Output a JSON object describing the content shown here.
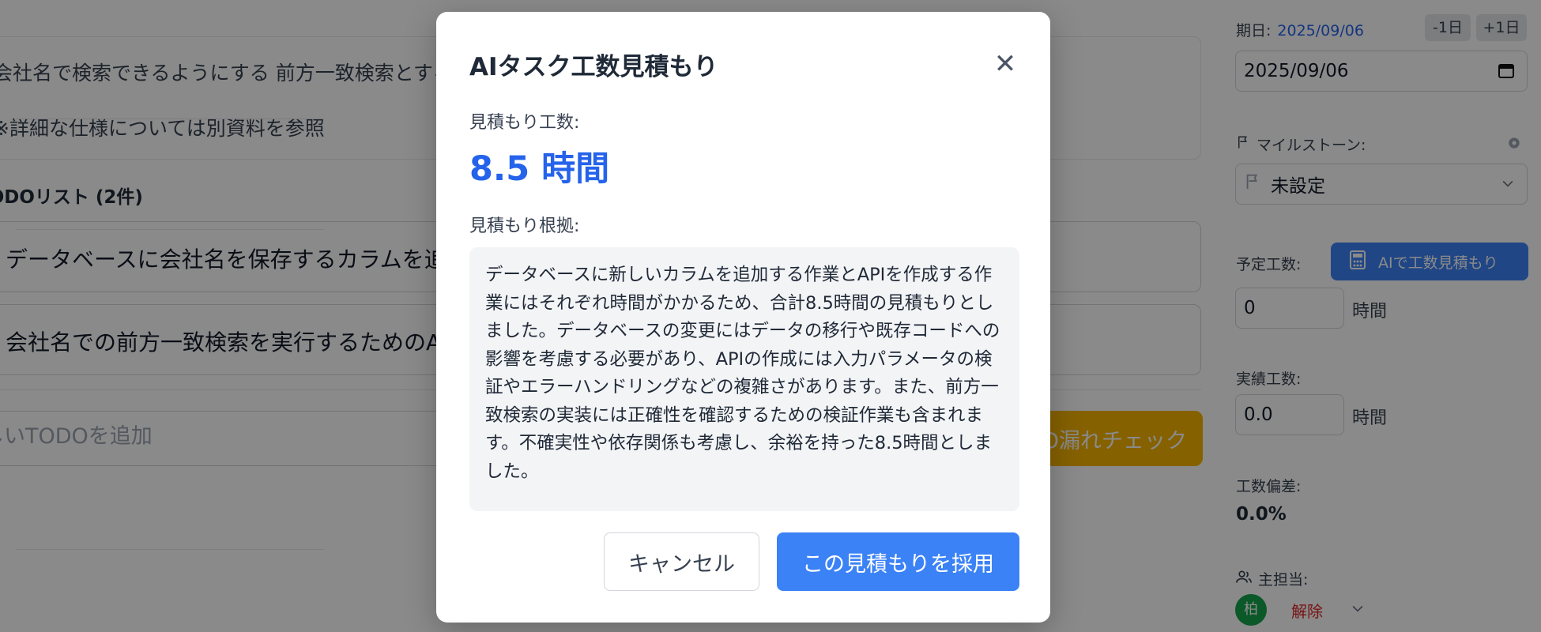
{
  "task": {
    "description_lines": [
      "会社名で検索できるようにする 前方一致検索とする",
      "※詳細な仕様については別資料を参照"
    ],
    "todo_header": "TODOリスト (2件)",
    "todos": [
      "データベースに会社名を保存するカラムを追加",
      "会社名での前方一致検索を実行するためのAPI"
    ],
    "new_todo_placeholder": "新しいTODOを追加",
    "check_button_label": "TODO漏れチェック"
  },
  "sidebar": {
    "due_date_label": "期日:",
    "due_date_value": "2025/09/06",
    "prev_day_label": "-1日",
    "next_day_label": "+1日",
    "date_input_value": "2025/09/06",
    "milestone_label": "マイルストーン:",
    "milestone_value": "未設定",
    "planned_hours_label": "予定工数:",
    "ai_estimate_button_label": "AIで工数見積もり",
    "planned_hours_value": "0",
    "hours_unit": "時間",
    "actual_hours_label": "実績工数:",
    "actual_hours_value": "0.0",
    "deviation_label": "工数偏差:",
    "deviation_value": "0.0%",
    "assignee_label": "主担当:",
    "assignee_initial": "柏",
    "unassign_label": "解除"
  },
  "modal": {
    "title": "AIタスク工数見積もり",
    "estimate_label": "見積もり工数:",
    "estimate_value": "8.5 時間",
    "reason_label": "見積もり根拠:",
    "reason_text": "データベースに新しいカラムを追加する作業とAPIを作成する作業にはそれぞれ時間がかかるため、合計8.5時間の見積もりとしました。データベースの変更にはデータの移行や既存コードへの影響を考慮する必要があり、APIの作成には入力パラメータの検証やエラーハンドリングなどの複雑さがあります。また、前方一致検索の実装には正確性を確認するための検証作業も含まれます。不確実性や依存関係も考慮し、余裕を持った8.5時間としました。",
    "cancel_label": "キャンセル",
    "accept_label": "この見積もりを採用"
  },
  "colors": {
    "accent": "#3b82f6",
    "estimate_text": "#2563eb",
    "warning_button": "#f5b400",
    "danger_text": "#dc2626",
    "avatar_bg": "#16a34a"
  },
  "icons": [
    "flag-icon",
    "gear-icon",
    "chevron-down-icon",
    "calculator-icon",
    "calendar-icon",
    "users-icon",
    "close-icon"
  ]
}
